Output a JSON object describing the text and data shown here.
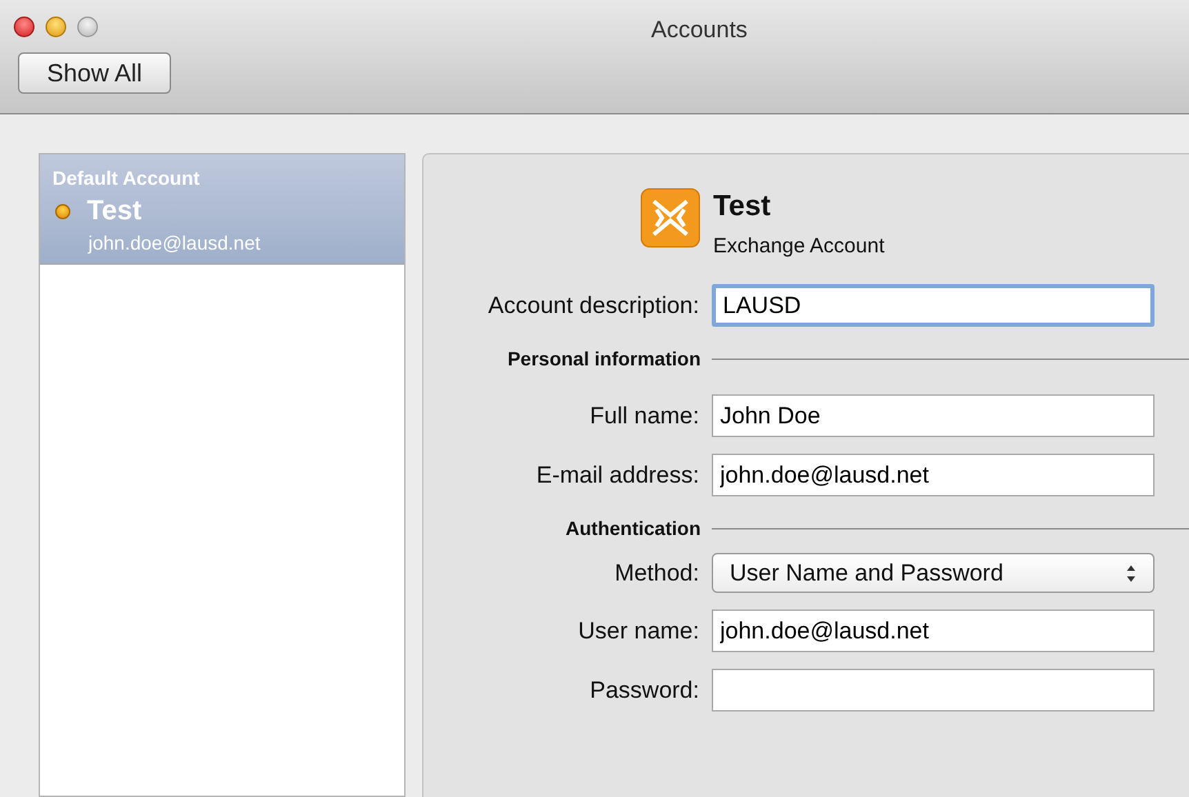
{
  "window": {
    "title": "Accounts"
  },
  "toolbar": {
    "show_all": "Show All"
  },
  "accounts": [
    {
      "group": "Default Account",
      "name": "Test",
      "email": "john.doe@lausd.net",
      "selected": true
    }
  ],
  "detail": {
    "name": "Test",
    "type": "Exchange Account",
    "rows": [
      {
        "kind": "field",
        "label": "Account description:",
        "value": "LAUSD",
        "focused": true
      },
      {
        "kind": "section",
        "label": "Personal information"
      },
      {
        "kind": "field",
        "label": "Full name:",
        "value": "John Doe",
        "focused": false
      },
      {
        "kind": "field",
        "label": "E-mail address:",
        "value": "john.doe@lausd.net",
        "focused": false
      },
      {
        "kind": "section",
        "label": "Authentication"
      },
      {
        "kind": "select",
        "label": "Method:",
        "value": "User Name and Password"
      },
      {
        "kind": "field",
        "label": "User name:",
        "value": "john.doe@lausd.net",
        "focused": false
      },
      {
        "kind": "field",
        "label": "Password:",
        "value": "",
        "focused": false
      }
    ]
  }
}
